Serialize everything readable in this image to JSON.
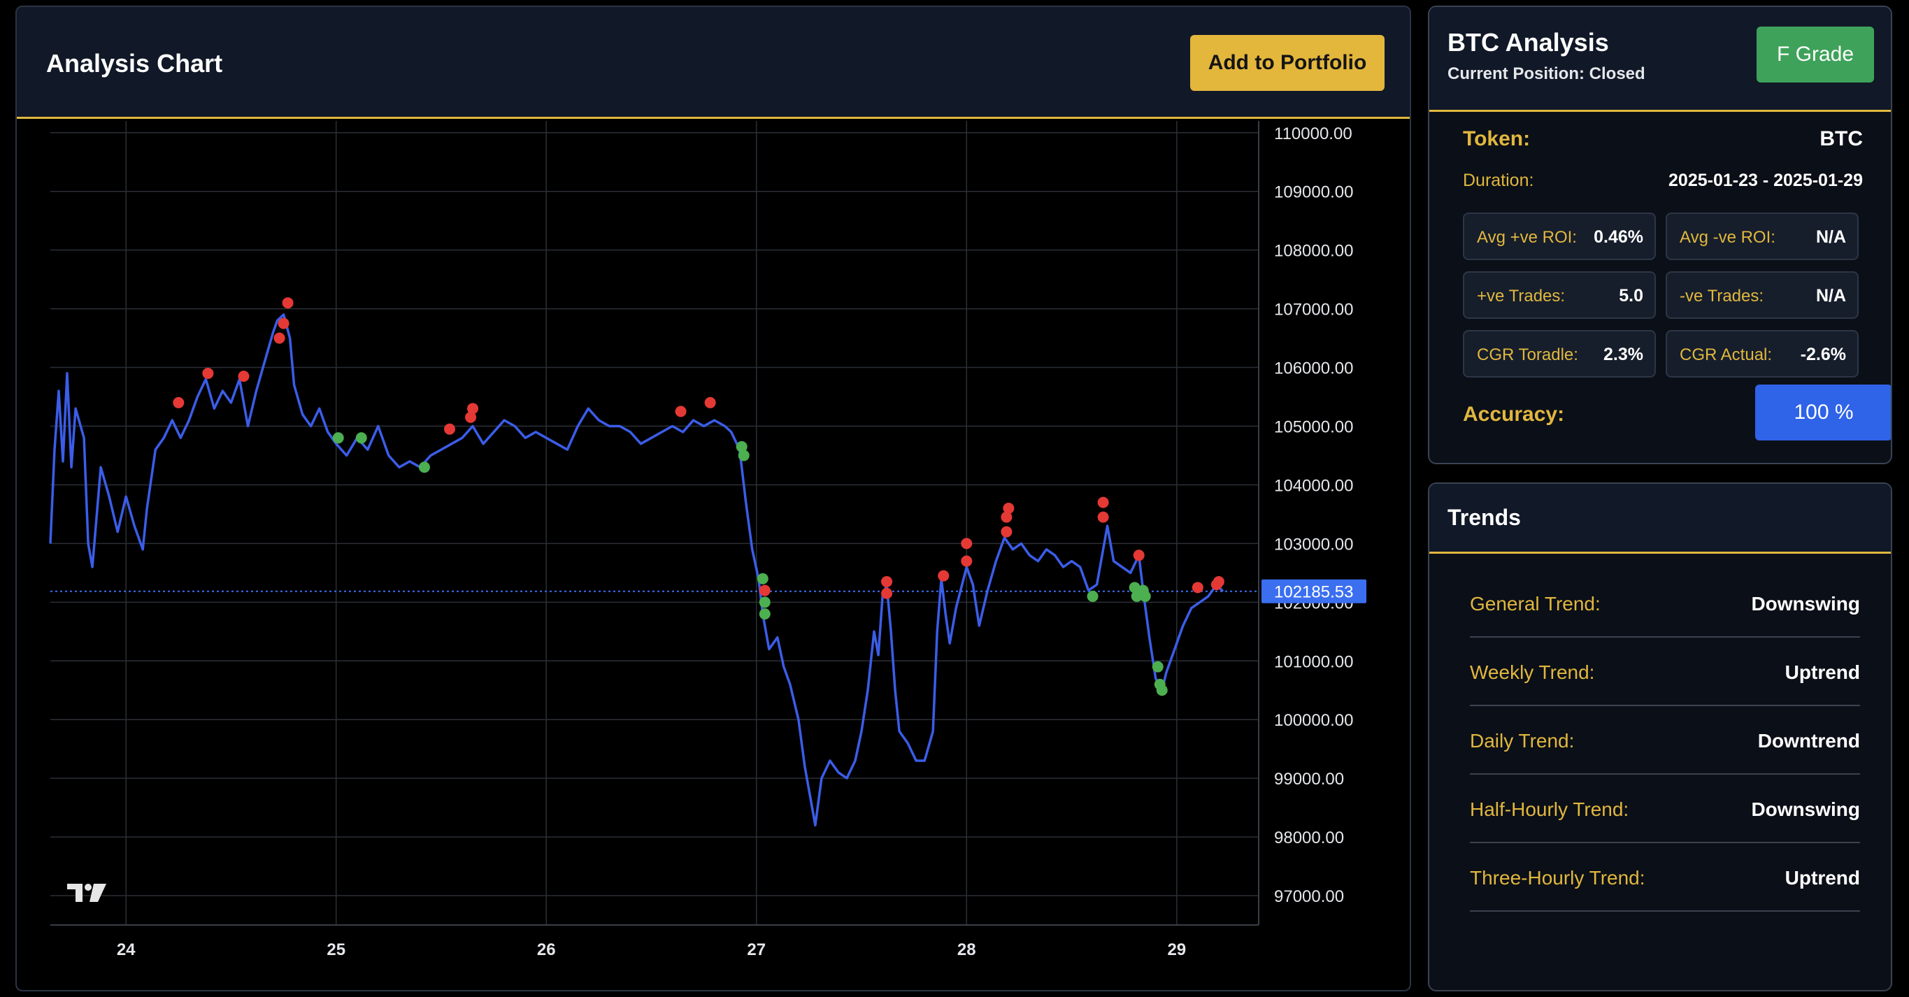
{
  "chart_panel": {
    "title": "Analysis Chart",
    "add_button_label": "Add to Portfolio"
  },
  "chart_data": {
    "type": "line",
    "title": "",
    "x_axis_tick_labels": [
      "24",
      "25",
      "26",
      "27",
      "28",
      "29"
    ],
    "y_axis_tick_labels": [
      "110000.00",
      "109000.00",
      "108000.00",
      "107000.00",
      "106000.00",
      "105000.00",
      "104000.00",
      "103000.00",
      "102000.00",
      "101000.00",
      "100000.00",
      "99000.00",
      "98000.00",
      "97000.00"
    ],
    "xlim": [
      23.64,
      29.39
    ],
    "ylim": [
      96500,
      110200
    ],
    "current_price_label": "102185.53",
    "current_price": 102185.53,
    "colors": {
      "line": "#3b5de8",
      "sell_marker": "#e53935",
      "buy_marker": "#4caf50",
      "price_line": "#3b6ff0",
      "grid": "#2b2f36"
    },
    "series": [
      {
        "values": [
          [
            23.64,
            103000
          ],
          [
            23.66,
            104600
          ],
          [
            23.68,
            105600
          ],
          [
            23.7,
            104400
          ],
          [
            23.72,
            105900
          ],
          [
            23.74,
            104300
          ],
          [
            23.76,
            105300
          ],
          [
            23.8,
            104800
          ],
          [
            23.82,
            103000
          ],
          [
            23.84,
            102600
          ],
          [
            23.88,
            104300
          ],
          [
            23.92,
            103800
          ],
          [
            23.96,
            103200
          ],
          [
            24.0,
            103800
          ],
          [
            24.04,
            103300
          ],
          [
            24.08,
            102900
          ],
          [
            24.1,
            103600
          ],
          [
            24.14,
            104600
          ],
          [
            24.18,
            104800
          ],
          [
            24.22,
            105100
          ],
          [
            24.26,
            104800
          ],
          [
            24.3,
            105100
          ],
          [
            24.34,
            105500
          ],
          [
            24.38,
            105800
          ],
          [
            24.42,
            105300
          ],
          [
            24.46,
            105600
          ],
          [
            24.5,
            105400
          ],
          [
            24.54,
            105800
          ],
          [
            24.58,
            105000
          ],
          [
            24.62,
            105600
          ],
          [
            24.66,
            106100
          ],
          [
            24.7,
            106600
          ],
          [
            24.72,
            106800
          ],
          [
            24.75,
            106900
          ],
          [
            24.78,
            106500
          ],
          [
            24.8,
            105700
          ],
          [
            24.84,
            105200
          ],
          [
            24.88,
            105000
          ],
          [
            24.92,
            105300
          ],
          [
            24.96,
            104900
          ],
          [
            25.0,
            104700
          ],
          [
            25.05,
            104500
          ],
          [
            25.1,
            104800
          ],
          [
            25.15,
            104600
          ],
          [
            25.2,
            105000
          ],
          [
            25.25,
            104500
          ],
          [
            25.3,
            104300
          ],
          [
            25.35,
            104400
          ],
          [
            25.4,
            104300
          ],
          [
            25.45,
            104500
          ],
          [
            25.5,
            104600
          ],
          [
            25.55,
            104700
          ],
          [
            25.6,
            104800
          ],
          [
            25.65,
            105000
          ],
          [
            25.7,
            104700
          ],
          [
            25.75,
            104900
          ],
          [
            25.8,
            105100
          ],
          [
            25.85,
            105000
          ],
          [
            25.9,
            104800
          ],
          [
            25.95,
            104900
          ],
          [
            26.0,
            104800
          ],
          [
            26.05,
            104700
          ],
          [
            26.1,
            104600
          ],
          [
            26.15,
            105000
          ],
          [
            26.2,
            105300
          ],
          [
            26.25,
            105100
          ],
          [
            26.3,
            105000
          ],
          [
            26.35,
            105000
          ],
          [
            26.4,
            104900
          ],
          [
            26.45,
            104700
          ],
          [
            26.5,
            104800
          ],
          [
            26.55,
            104900
          ],
          [
            26.6,
            105000
          ],
          [
            26.65,
            104900
          ],
          [
            26.7,
            105100
          ],
          [
            26.75,
            105000
          ],
          [
            26.8,
            105100
          ],
          [
            26.85,
            105000
          ],
          [
            26.88,
            104900
          ],
          [
            26.92,
            104600
          ],
          [
            26.95,
            103700
          ],
          [
            26.98,
            102900
          ],
          [
            27.01,
            102400
          ],
          [
            27.03,
            101800
          ],
          [
            27.06,
            101200
          ],
          [
            27.1,
            101400
          ],
          [
            27.13,
            100900
          ],
          [
            27.16,
            100600
          ],
          [
            27.2,
            100000
          ],
          [
            27.23,
            99200
          ],
          [
            27.26,
            98600
          ],
          [
            27.28,
            98200
          ],
          [
            27.31,
            99000
          ],
          [
            27.35,
            99300
          ],
          [
            27.39,
            99100
          ],
          [
            27.43,
            99000
          ],
          [
            27.47,
            99300
          ],
          [
            27.5,
            99800
          ],
          [
            27.53,
            100500
          ],
          [
            27.56,
            101500
          ],
          [
            27.58,
            101100
          ],
          [
            27.6,
            102100
          ],
          [
            27.62,
            102300
          ],
          [
            27.64,
            101500
          ],
          [
            27.66,
            100500
          ],
          [
            27.68,
            99800
          ],
          [
            27.72,
            99600
          ],
          [
            27.76,
            99300
          ],
          [
            27.8,
            99300
          ],
          [
            27.84,
            99800
          ],
          [
            27.86,
            101500
          ],
          [
            27.88,
            102400
          ],
          [
            27.9,
            101800
          ],
          [
            27.92,
            101300
          ],
          [
            27.95,
            101900
          ],
          [
            28.0,
            102600
          ],
          [
            28.03,
            102300
          ],
          [
            28.06,
            101600
          ],
          [
            28.1,
            102200
          ],
          [
            28.14,
            102700
          ],
          [
            28.18,
            103100
          ],
          [
            28.22,
            102900
          ],
          [
            28.26,
            103000
          ],
          [
            28.3,
            102800
          ],
          [
            28.34,
            102700
          ],
          [
            28.38,
            102900
          ],
          [
            28.42,
            102800
          ],
          [
            28.46,
            102600
          ],
          [
            28.5,
            102700
          ],
          [
            28.54,
            102600
          ],
          [
            28.58,
            102200
          ],
          [
            28.62,
            102300
          ],
          [
            28.65,
            102900
          ],
          [
            28.67,
            103300
          ],
          [
            28.7,
            102700
          ],
          [
            28.74,
            102600
          ],
          [
            28.78,
            102500
          ],
          [
            28.82,
            102800
          ],
          [
            28.84,
            102200
          ],
          [
            28.87,
            101400
          ],
          [
            28.9,
            100700
          ],
          [
            28.93,
            100500
          ],
          [
            28.95,
            100800
          ],
          [
            28.99,
            101200
          ],
          [
            29.03,
            101600
          ],
          [
            29.07,
            101900
          ],
          [
            29.11,
            102000
          ],
          [
            29.15,
            102100
          ],
          [
            29.19,
            102300
          ],
          [
            29.22,
            102185
          ]
        ]
      }
    ],
    "sell_markers": [
      [
        24.25,
        105400
      ],
      [
        24.39,
        105900
      ],
      [
        24.56,
        105850
      ],
      [
        24.73,
        106500
      ],
      [
        24.75,
        106750
      ],
      [
        24.77,
        107100
      ],
      [
        25.54,
        104950
      ],
      [
        25.64,
        105150
      ],
      [
        25.65,
        105300
      ],
      [
        26.64,
        105250
      ],
      [
        26.78,
        105400
      ],
      [
        27.04,
        102200
      ],
      [
        27.62,
        102350
      ],
      [
        27.62,
        102150
      ],
      [
        27.89,
        102450
      ],
      [
        28.0,
        103000
      ],
      [
        28.0,
        102700
      ],
      [
        28.19,
        103200
      ],
      [
        28.19,
        103450
      ],
      [
        28.2,
        103600
      ],
      [
        28.65,
        103450
      ],
      [
        28.65,
        103700
      ],
      [
        28.82,
        102800
      ],
      [
        29.1,
        102250
      ],
      [
        29.19,
        102300
      ],
      [
        29.2,
        102350
      ]
    ],
    "buy_markers": [
      [
        25.01,
        104800
      ],
      [
        25.12,
        104800
      ],
      [
        25.42,
        104300
      ],
      [
        26.93,
        104650
      ],
      [
        26.94,
        104500
      ],
      [
        27.03,
        102400
      ],
      [
        27.04,
        102000
      ],
      [
        27.04,
        101800
      ],
      [
        28.6,
        102100
      ],
      [
        28.8,
        102250
      ],
      [
        28.81,
        102100
      ],
      [
        28.84,
        102200
      ],
      [
        28.85,
        102100
      ],
      [
        28.91,
        100900
      ],
      [
        28.92,
        100600
      ],
      [
        28.93,
        100500
      ]
    ]
  },
  "analysis": {
    "title": "BTC Analysis",
    "subtitle": "Current Position: Closed",
    "grade_label": "F Grade",
    "grade_color": "#3fa25a",
    "token_label": "Token:",
    "token_value": "BTC",
    "duration_label": "Duration:",
    "duration_value": "2025-01-23 - 2025-01-29",
    "stats": [
      {
        "label": "Avg +ve ROI:",
        "value": "0.46%"
      },
      {
        "label": "Avg -ve ROI:",
        "value": "N/A"
      },
      {
        "label": "+ve Trades:",
        "value": "5.0"
      },
      {
        "label": "-ve Trades:",
        "value": "N/A"
      },
      {
        "label": "CGR Toradle:",
        "value": "2.3%"
      },
      {
        "label": "CGR Actual:",
        "value": "-2.6%"
      }
    ],
    "accuracy_label": "Accuracy:",
    "accuracy_value": "100 %",
    "accuracy_color": "#2f63e8"
  },
  "trends": {
    "title": "Trends",
    "rows": [
      {
        "label": "General Trend:",
        "value": "Downswing"
      },
      {
        "label": "Weekly Trend:",
        "value": "Uptrend"
      },
      {
        "label": "Daily Trend:",
        "value": "Downtrend"
      },
      {
        "label": "Half-Hourly Trend:",
        "value": "Downswing"
      },
      {
        "label": "Three-Hourly Trend:",
        "value": "Uptrend"
      }
    ]
  },
  "accent_color": "#e1b73e"
}
